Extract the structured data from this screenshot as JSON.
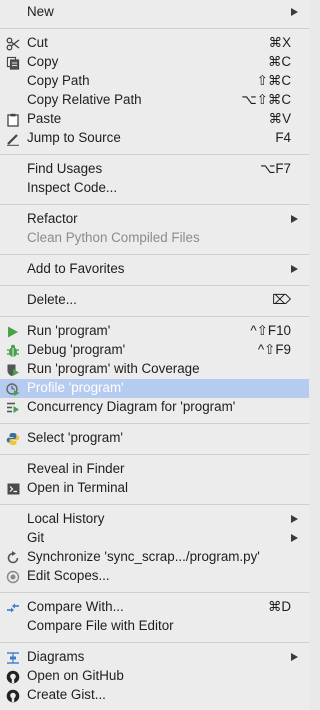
{
  "menu": {
    "new": "New",
    "cut": "Cut",
    "cut_sc": "⌘X",
    "copy": "Copy",
    "copy_sc": "⌘C",
    "copy_path": "Copy Path",
    "copy_path_sc": "⇧⌘C",
    "copy_rel": "Copy Relative Path",
    "copy_rel_sc": "⌥⇧⌘C",
    "paste": "Paste",
    "paste_sc": "⌘V",
    "jump": "Jump to Source",
    "jump_sc": "F4",
    "find": "Find Usages",
    "find_sc": "⌥F7",
    "inspect": "Inspect Code...",
    "refactor": "Refactor",
    "clean": "Clean Python Compiled Files",
    "favorites": "Add to Favorites",
    "delete": "Delete...",
    "delete_sc": "⌦",
    "run": "Run 'program'",
    "run_sc": "^⇧F10",
    "debug": "Debug 'program'",
    "debug_sc": "^⇧F9",
    "coverage": "Run 'program' with Coverage",
    "profile": "Profile 'program'",
    "concurrency": "Concurrency Diagram for 'program'",
    "select": "Select 'program'",
    "reveal": "Reveal in Finder",
    "terminal": "Open in Terminal",
    "history": "Local History",
    "git": "Git",
    "sync": "Synchronize 'sync_scrap.../program.py'",
    "scopes": "Edit Scopes...",
    "compare": "Compare With...",
    "compare_sc": "⌘D",
    "compare_editor": "Compare File with Editor",
    "diagrams": "Diagrams",
    "github": "Open on GitHub",
    "gist": "Create Gist..."
  },
  "colors": {
    "highlight": "#b6cbf0",
    "run_green": "#4aa14a",
    "python_blue": "#3b6fa0",
    "python_yellow": "#f2c43a"
  }
}
